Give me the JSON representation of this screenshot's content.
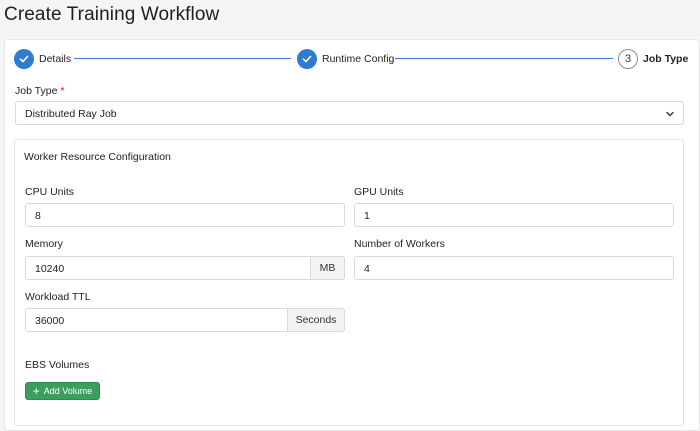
{
  "page_title": "Create Training Workflow",
  "stepper": {
    "steps": [
      {
        "label": "Details",
        "state": "done"
      },
      {
        "label": "Runtime Config",
        "state": "done"
      },
      {
        "label": "Job Type",
        "state": "current",
        "number": "3"
      }
    ]
  },
  "job_type": {
    "label": "Job Type",
    "required_mark": "*",
    "selected": "Distributed Ray Job"
  },
  "worker_config": {
    "title": "Worker Resource Configuration",
    "cpu": {
      "label": "CPU Units",
      "value": "8"
    },
    "gpu": {
      "label": "GPU Units",
      "value": "1"
    },
    "memory": {
      "label": "Memory",
      "value": "10240",
      "unit": "MB"
    },
    "workers": {
      "label": "Number of Workers",
      "value": "4"
    },
    "ttl": {
      "label": "Workload TTL",
      "value": "36000",
      "unit": "Seconds"
    },
    "ebs": {
      "label": "EBS Volumes",
      "add_button": "Add Volume"
    }
  },
  "colors": {
    "accent": "#2e7bcf",
    "success": "#3a9e5c",
    "required": "#d0021b"
  }
}
